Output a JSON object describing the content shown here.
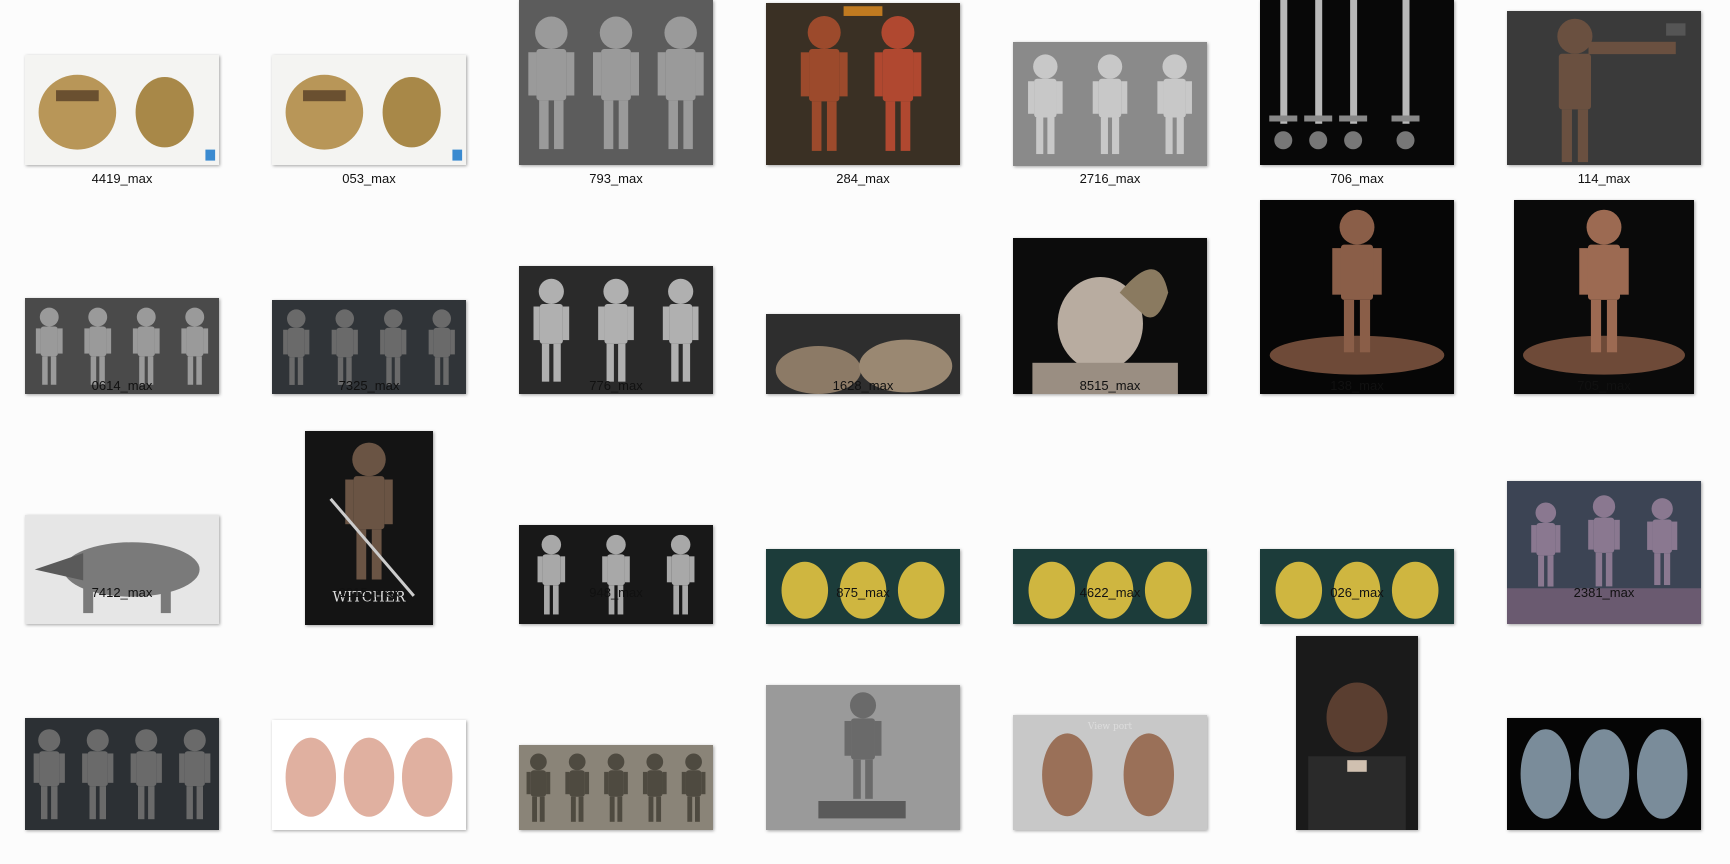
{
  "items": [
    {
      "label": "4419_max",
      "subject": "backpack",
      "bg": "#f4f4f2",
      "fg": "#b89658"
    },
    {
      "label": "053_max",
      "subject": "backpack",
      "bg": "#f4f4f2",
      "fg": "#b89658"
    },
    {
      "label": "793_max",
      "subject": "armored-figures-sculpt",
      "bg": "#5c5c5c",
      "fg": "#9a9a9a"
    },
    {
      "label": "284_max",
      "subject": "demon-warriors",
      "bg": "#3a3024",
      "fg": "#9c4a2c"
    },
    {
      "label": "2716_max",
      "subject": "armored-figures-sculpt",
      "bg": "#8a8a8a",
      "fg": "#c8c8c8"
    },
    {
      "label": "706_max",
      "subject": "swords",
      "bg": "#080808",
      "fg": "#b8b8b8"
    },
    {
      "label": "114_max",
      "subject": "gunman",
      "bg": "#3a3a3a",
      "fg": "#6a5040"
    },
    {
      "label": "0614_max",
      "subject": "armored-figures-lineup",
      "bg": "#4a4a4a",
      "fg": "#9a9a9a"
    },
    {
      "label": "7325_max",
      "subject": "armored-figures-lineup",
      "bg": "#303438",
      "fg": "#6a6a6a"
    },
    {
      "label": "776_max",
      "subject": "body-sculpt",
      "bg": "#2a2a2a",
      "fg": "#b0b0b0"
    },
    {
      "label": "1628_max",
      "subject": "creature-sculpt",
      "bg": "#2e2e2e",
      "fg": "#8c7a66"
    },
    {
      "label": "8515_max",
      "subject": "demon-bust",
      "bg": "#0c0c0c",
      "fg": "#b8aca0"
    },
    {
      "label": "138_max",
      "subject": "demon-statue",
      "bg": "#060606",
      "fg": "#8a5e48"
    },
    {
      "label": "705_max",
      "subject": "demon-statue",
      "bg": "#0a0a0a",
      "fg": "#9c6a52"
    },
    {
      "label": "7412_max",
      "subject": "dragon-creature",
      "bg": "#e6e6e6",
      "fg": "#7a7a7a"
    },
    {
      "label": "2015_max",
      "subject": "witcher-warrior",
      "bg": "#141414",
      "fg": "#6a5444",
      "caption": "WITCHER"
    },
    {
      "label": "948_max",
      "subject": "soldiers",
      "bg": "#181818",
      "fg": "#a8a8a8"
    },
    {
      "label": "875_max",
      "subject": "yellow-golems",
      "bg": "#1c3c3a",
      "fg": "#cfb640"
    },
    {
      "label": "4622_max",
      "subject": "yellow-golems",
      "bg": "#1c3c3a",
      "fg": "#cfb640"
    },
    {
      "label": "026_max",
      "subject": "yellow-golems",
      "bg": "#1c3c3a",
      "fg": "#cfb640"
    },
    {
      "label": "2381_max",
      "subject": "alien-statues",
      "bg": "#3c4454",
      "fg": "#8a7890"
    },
    {
      "label": "",
      "subject": "armored-figures-lineup",
      "bg": "#2c3034",
      "fg": "#6a6a6a"
    },
    {
      "label": "",
      "subject": "heads",
      "bg": "#ffffff",
      "fg": "#e0b0a0"
    },
    {
      "label": "",
      "subject": "soldiers",
      "bg": "#8a8478",
      "fg": "#4e4a40"
    },
    {
      "label": "",
      "subject": "soldier-statue",
      "bg": "#9a9a9a",
      "fg": "#6a6a6a"
    },
    {
      "label": "",
      "subject": "heads",
      "bg": "#c8c8c8",
      "fg": "#9a7058",
      "caption": "View port"
    },
    {
      "label": "",
      "subject": "old-man-portrait",
      "bg": "#1a1a1a",
      "fg": "#5a3e30"
    },
    {
      "label": "",
      "subject": "blue-heads",
      "bg": "#050505",
      "fg": "#7a8c9a"
    }
  ]
}
